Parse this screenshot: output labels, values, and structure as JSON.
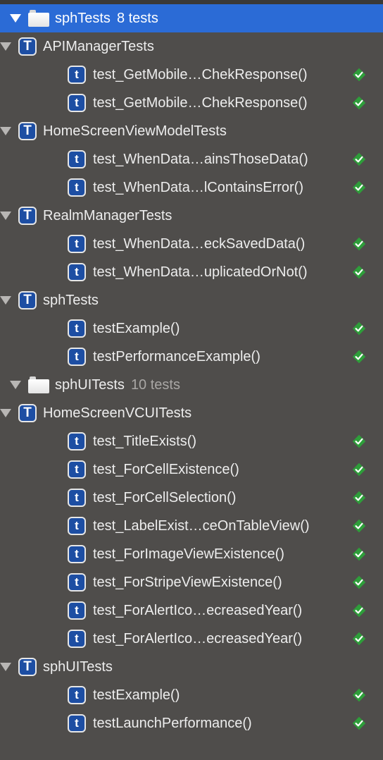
{
  "tree": [
    {
      "kind": "bundle",
      "label": "sphTests",
      "count": "8 tests",
      "selected": true
    },
    {
      "kind": "class",
      "label": "APIManagerTests",
      "icon": "T"
    },
    {
      "kind": "method",
      "label": "test_GetMobile…ChekResponse()",
      "icon": "t",
      "status": "passed"
    },
    {
      "kind": "method",
      "label": "test_GetMobile…ChekResponse()",
      "icon": "t",
      "status": "passed"
    },
    {
      "kind": "class",
      "label": "HomeScreenViewModelTests",
      "icon": "T"
    },
    {
      "kind": "method",
      "label": "test_WhenData…ainsThoseData()",
      "icon": "t",
      "status": "passed"
    },
    {
      "kind": "method",
      "label": "test_WhenData…lContainsError()",
      "icon": "t",
      "status": "passed"
    },
    {
      "kind": "class",
      "label": "RealmManagerTests",
      "icon": "T"
    },
    {
      "kind": "method",
      "label": "test_WhenData…eckSavedData()",
      "icon": "t",
      "status": "passed"
    },
    {
      "kind": "method",
      "label": "test_WhenData…uplicatedOrNot()",
      "icon": "t",
      "status": "passed"
    },
    {
      "kind": "class",
      "label": "sphTests",
      "icon": "T"
    },
    {
      "kind": "method",
      "label": "testExample()",
      "icon": "t",
      "status": "passed"
    },
    {
      "kind": "method",
      "label": "testPerformanceExample()",
      "icon": "t",
      "status": "passed"
    },
    {
      "kind": "bundle",
      "label": "sphUITests",
      "count": "10 tests",
      "selected": false
    },
    {
      "kind": "class",
      "label": "HomeScreenVCUITests",
      "icon": "T"
    },
    {
      "kind": "method",
      "label": "test_TitleExists()",
      "icon": "t",
      "status": "passed"
    },
    {
      "kind": "method",
      "label": "test_ForCellExistence()",
      "icon": "t",
      "status": "passed"
    },
    {
      "kind": "method",
      "label": "test_ForCellSelection()",
      "icon": "t",
      "status": "passed"
    },
    {
      "kind": "method",
      "label": "test_LabelExist…ceOnTableView()",
      "icon": "t",
      "status": "passed"
    },
    {
      "kind": "method",
      "label": "test_ForImageViewExistence()",
      "icon": "t",
      "status": "passed"
    },
    {
      "kind": "method",
      "label": "test_ForStripeViewExistence()",
      "icon": "t",
      "status": "passed"
    },
    {
      "kind": "method",
      "label": "test_ForAlertIco…ecreasedYear()",
      "icon": "t",
      "status": "passed"
    },
    {
      "kind": "method",
      "label": "test_ForAlertIco…ecreasedYear()",
      "icon": "t",
      "status": "passed"
    },
    {
      "kind": "class",
      "label": "sphUITests",
      "icon": "T"
    },
    {
      "kind": "method",
      "label": "testExample()",
      "icon": "t",
      "status": "passed"
    },
    {
      "kind": "method",
      "label": "testLaunchPerformance()",
      "icon": "t",
      "status": "passed"
    }
  ],
  "colors": {
    "background": "#4f4d4b",
    "selection": "#2b6bd6",
    "pass": "#2e9e3a",
    "test_icon": "#1d4ea3"
  }
}
